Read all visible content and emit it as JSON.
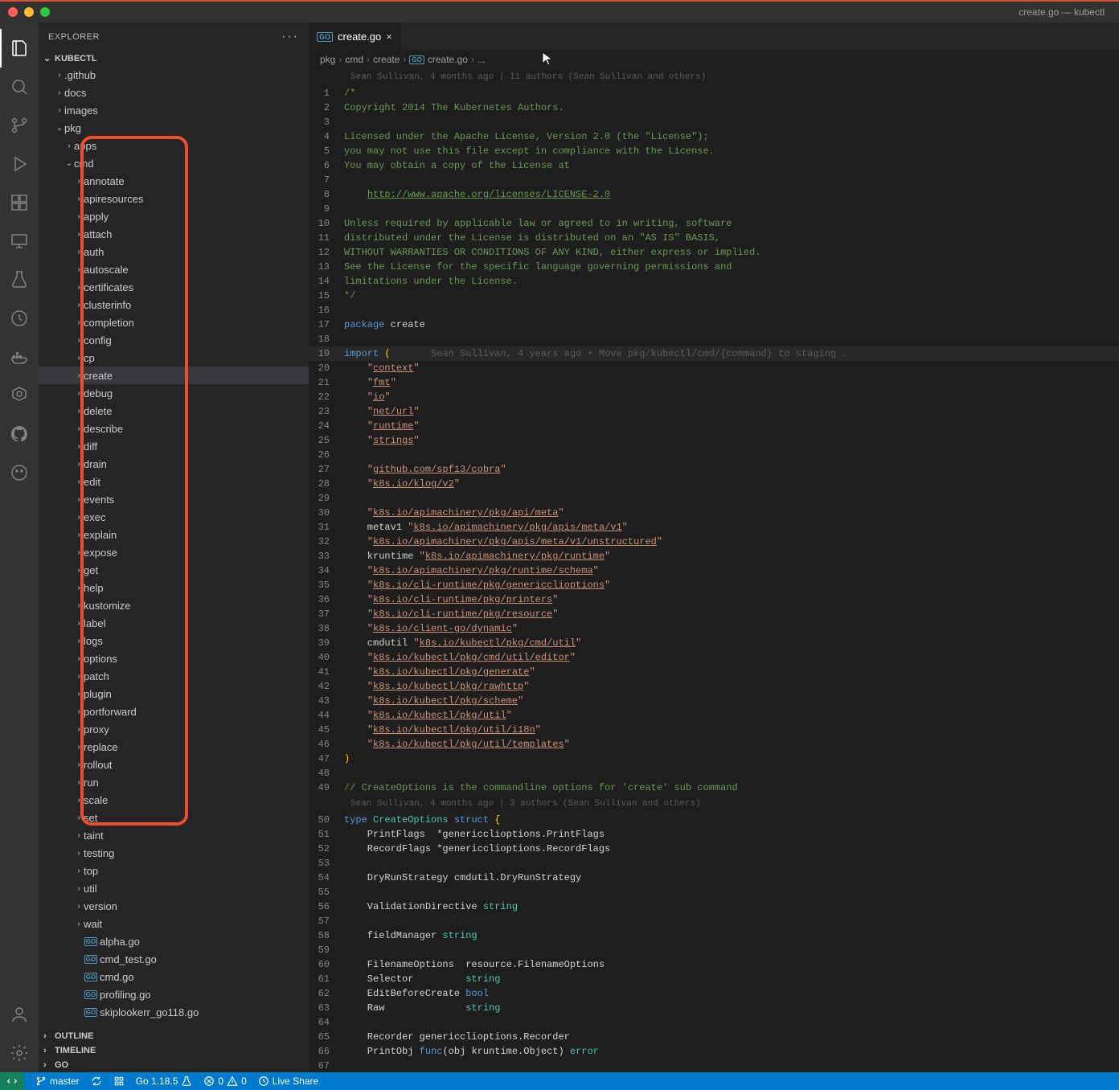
{
  "window": {
    "title": "create.go — kubectl"
  },
  "sidebar": {
    "header": "EXPLORER",
    "sections": {
      "project": "KUBECTL",
      "outline": "OUTLINE",
      "timeline": "TIMELINE",
      "golang": "GO"
    },
    "tree": [
      {
        "label": ".github",
        "depth": 1,
        "type": "folder",
        "expanded": false
      },
      {
        "label": "docs",
        "depth": 1,
        "type": "folder",
        "expanded": false
      },
      {
        "label": "images",
        "depth": 1,
        "type": "folder",
        "expanded": false
      },
      {
        "label": "pkg",
        "depth": 1,
        "type": "folder",
        "expanded": true
      },
      {
        "label": "apps",
        "depth": 2,
        "type": "folder",
        "expanded": false
      },
      {
        "label": "cmd",
        "depth": 2,
        "type": "folder",
        "expanded": true
      },
      {
        "label": "annotate",
        "depth": 3,
        "type": "folder",
        "expanded": false
      },
      {
        "label": "apiresources",
        "depth": 3,
        "type": "folder",
        "expanded": false
      },
      {
        "label": "apply",
        "depth": 3,
        "type": "folder",
        "expanded": false
      },
      {
        "label": "attach",
        "depth": 3,
        "type": "folder",
        "expanded": false
      },
      {
        "label": "auth",
        "depth": 3,
        "type": "folder",
        "expanded": false
      },
      {
        "label": "autoscale",
        "depth": 3,
        "type": "folder",
        "expanded": false
      },
      {
        "label": "certificates",
        "depth": 3,
        "type": "folder",
        "expanded": false
      },
      {
        "label": "clusterinfo",
        "depth": 3,
        "type": "folder",
        "expanded": false
      },
      {
        "label": "completion",
        "depth": 3,
        "type": "folder",
        "expanded": false
      },
      {
        "label": "config",
        "depth": 3,
        "type": "folder",
        "expanded": false
      },
      {
        "label": "cp",
        "depth": 3,
        "type": "folder",
        "expanded": false
      },
      {
        "label": "create",
        "depth": 3,
        "type": "folder",
        "expanded": false,
        "selected": true
      },
      {
        "label": "debug",
        "depth": 3,
        "type": "folder",
        "expanded": false
      },
      {
        "label": "delete",
        "depth": 3,
        "type": "folder",
        "expanded": false
      },
      {
        "label": "describe",
        "depth": 3,
        "type": "folder",
        "expanded": false
      },
      {
        "label": "diff",
        "depth": 3,
        "type": "folder",
        "expanded": false
      },
      {
        "label": "drain",
        "depth": 3,
        "type": "folder",
        "expanded": false
      },
      {
        "label": "edit",
        "depth": 3,
        "type": "folder",
        "expanded": false
      },
      {
        "label": "events",
        "depth": 3,
        "type": "folder",
        "expanded": false
      },
      {
        "label": "exec",
        "depth": 3,
        "type": "folder",
        "expanded": false
      },
      {
        "label": "explain",
        "depth": 3,
        "type": "folder",
        "expanded": false
      },
      {
        "label": "expose",
        "depth": 3,
        "type": "folder",
        "expanded": false
      },
      {
        "label": "get",
        "depth": 3,
        "type": "folder",
        "expanded": false
      },
      {
        "label": "help",
        "depth": 3,
        "type": "folder",
        "expanded": false
      },
      {
        "label": "kustomize",
        "depth": 3,
        "type": "folder",
        "expanded": false
      },
      {
        "label": "label",
        "depth": 3,
        "type": "folder",
        "expanded": false
      },
      {
        "label": "logs",
        "depth": 3,
        "type": "folder",
        "expanded": false
      },
      {
        "label": "options",
        "depth": 3,
        "type": "folder",
        "expanded": false
      },
      {
        "label": "patch",
        "depth": 3,
        "type": "folder",
        "expanded": false
      },
      {
        "label": "plugin",
        "depth": 3,
        "type": "folder",
        "expanded": false
      },
      {
        "label": "portforward",
        "depth": 3,
        "type": "folder",
        "expanded": false
      },
      {
        "label": "proxy",
        "depth": 3,
        "type": "folder",
        "expanded": false
      },
      {
        "label": "replace",
        "depth": 3,
        "type": "folder",
        "expanded": false
      },
      {
        "label": "rollout",
        "depth": 3,
        "type": "folder",
        "expanded": false
      },
      {
        "label": "run",
        "depth": 3,
        "type": "folder",
        "expanded": false
      },
      {
        "label": "scale",
        "depth": 3,
        "type": "folder",
        "expanded": false
      },
      {
        "label": "set",
        "depth": 3,
        "type": "folder",
        "expanded": false
      },
      {
        "label": "taint",
        "depth": 3,
        "type": "folder",
        "expanded": false
      },
      {
        "label": "testing",
        "depth": 3,
        "type": "folder",
        "expanded": false
      },
      {
        "label": "top",
        "depth": 3,
        "type": "folder",
        "expanded": false
      },
      {
        "label": "util",
        "depth": 3,
        "type": "folder",
        "expanded": false
      },
      {
        "label": "version",
        "depth": 3,
        "type": "folder",
        "expanded": false
      },
      {
        "label": "wait",
        "depth": 3,
        "type": "folder",
        "expanded": false
      },
      {
        "label": "alpha.go",
        "depth": 3,
        "type": "go"
      },
      {
        "label": "cmd_test.go",
        "depth": 3,
        "type": "go"
      },
      {
        "label": "cmd.go",
        "depth": 3,
        "type": "go"
      },
      {
        "label": "profiling.go",
        "depth": 3,
        "type": "go"
      },
      {
        "label": "skiplookerr_go118.go",
        "depth": 3,
        "type": "go"
      }
    ]
  },
  "tab": {
    "filename": "create.go"
  },
  "breadcrumb": [
    "pkg",
    "cmd",
    "create",
    "create.go",
    "..."
  ],
  "blame": {
    "top": "Sean Sullivan, 4 months ago | 11 authors (Sean Sullivan and others)",
    "import_hint": "Sean Sullivan, 4 years ago • Move pkg/kubectl/cmd/{command} to staging …",
    "struct_hint": "Sean Sullivan, 4 months ago | 3 authors (Sean Sullivan and others)"
  },
  "code": [
    {
      "n": 1,
      "html": "<span class='c-comment'>/*</span>"
    },
    {
      "n": 2,
      "html": "<span class='c-comment'>Copyright 2014 The Kubernetes Authors.</span>"
    },
    {
      "n": 3,
      "html": ""
    },
    {
      "n": 4,
      "html": "<span class='c-comment'>Licensed under the Apache License, Version 2.0 (the \"License\");</span>"
    },
    {
      "n": 5,
      "html": "<span class='c-comment'>you may not use this file except in compliance with the License.</span>"
    },
    {
      "n": 6,
      "html": "<span class='c-comment'>You may obtain a copy of the License at</span>"
    },
    {
      "n": 7,
      "html": ""
    },
    {
      "n": 8,
      "html": "<span class='c-comment'>    <span class='c-url'>http://www.apache.org/licenses/LICENSE-2.0</span></span>"
    },
    {
      "n": 9,
      "html": ""
    },
    {
      "n": 10,
      "html": "<span class='c-comment'>Unless required by applicable law or agreed to in writing, software</span>"
    },
    {
      "n": 11,
      "html": "<span class='c-comment'>distributed under the License is distributed on an \"AS IS\" BASIS,</span>"
    },
    {
      "n": 12,
      "html": "<span class='c-comment'>WITHOUT WARRANTIES OR CONDITIONS OF ANY KIND, either express or implied.</span>"
    },
    {
      "n": 13,
      "html": "<span class='c-comment'>See the License for the specific language governing permissions and</span>"
    },
    {
      "n": 14,
      "html": "<span class='c-comment'>limitations under the License.</span>"
    },
    {
      "n": 15,
      "html": "<span class='c-comment'>*/</span>"
    },
    {
      "n": 16,
      "html": ""
    },
    {
      "n": 17,
      "html": "<span class='c-kw'>package</span> create"
    },
    {
      "n": 18,
      "html": ""
    },
    {
      "n": 19,
      "hl": true,
      "html": "<span class='c-kw'>import</span> <span class='c-punc'>(</span>       <span class='c-hint'>Sean Sullivan, 4 years ago • Move pkg/kubectl/cmd/{command} to staging …</span>"
    },
    {
      "n": 20,
      "html": "    <span class='c-str'>\"<span class='c-strlink'>context</span>\"</span>"
    },
    {
      "n": 21,
      "html": "    <span class='c-str'>\"<span class='c-strlink'>fmt</span>\"</span>"
    },
    {
      "n": 22,
      "html": "    <span class='c-str'>\"<span class='c-strlink'>io</span>\"</span>"
    },
    {
      "n": 23,
      "html": "    <span class='c-str'>\"<span class='c-strlink'>net/url</span>\"</span>"
    },
    {
      "n": 24,
      "html": "    <span class='c-str'>\"<span class='c-strlink'>runtime</span>\"</span>"
    },
    {
      "n": 25,
      "html": "    <span class='c-str'>\"<span class='c-strlink'>strings</span>\"</span>"
    },
    {
      "n": 26,
      "html": ""
    },
    {
      "n": 27,
      "html": "    <span class='c-str'>\"<span class='c-strlink'>github.com/spf13/cobra</span>\"</span>"
    },
    {
      "n": 28,
      "html": "    <span class='c-str'>\"<span class='c-strlink'>k8s.io/klog/v2</span>\"</span>"
    },
    {
      "n": 29,
      "html": ""
    },
    {
      "n": 30,
      "html": "    <span class='c-str'>\"<span class='c-strlink'>k8s.io/apimachinery/pkg/api/meta</span>\"</span>"
    },
    {
      "n": 31,
      "html": "    metav1 <span class='c-str'>\"<span class='c-strlink'>k8s.io/apimachinery/pkg/apis/meta/v1</span>\"</span>"
    },
    {
      "n": 32,
      "html": "    <span class='c-str'>\"<span class='c-strlink'>k8s.io/apimachinery/pkg/apis/meta/v1/unstructured</span>\"</span>"
    },
    {
      "n": 33,
      "html": "    kruntime <span class='c-str'>\"<span class='c-strlink'>k8s.io/apimachinery/pkg/runtime</span>\"</span>"
    },
    {
      "n": 34,
      "html": "    <span class='c-str'>\"<span class='c-strlink'>k8s.io/apimachinery/pkg/runtime/schema</span>\"</span>"
    },
    {
      "n": 35,
      "html": "    <span class='c-str'>\"<span class='c-strlink'>k8s.io/cli-runtime/pkg/genericclioptions</span>\"</span>"
    },
    {
      "n": 36,
      "html": "    <span class='c-str'>\"<span class='c-strlink'>k8s.io/cli-runtime/pkg/printers</span>\"</span>"
    },
    {
      "n": 37,
      "html": "    <span class='c-str'>\"<span class='c-strlink'>k8s.io/cli-runtime/pkg/resource</span>\"</span>"
    },
    {
      "n": 38,
      "html": "    <span class='c-str'>\"<span class='c-strlink'>k8s.io/client-go/dynamic</span>\"</span>"
    },
    {
      "n": 39,
      "html": "    cmdutil <span class='c-str'>\"<span class='c-strlink'>k8s.io/kubectl/pkg/cmd/util</span>\"</span>"
    },
    {
      "n": 40,
      "html": "    <span class='c-str'>\"<span class='c-strlink'>k8s.io/kubectl/pkg/cmd/util/editor</span>\"</span>"
    },
    {
      "n": 41,
      "html": "    <span class='c-str'>\"<span class='c-strlink'>k8s.io/kubectl/pkg/generate</span>\"</span>"
    },
    {
      "n": 42,
      "html": "    <span class='c-str'>\"<span class='c-strlink'>k8s.io/kubectl/pkg/rawhttp</span>\"</span>"
    },
    {
      "n": 43,
      "html": "    <span class='c-str'>\"<span class='c-strlink'>k8s.io/kubectl/pkg/scheme</span>\"</span>"
    },
    {
      "n": 44,
      "html": "    <span class='c-str'>\"<span class='c-strlink'>k8s.io/kubectl/pkg/util</span>\"</span>"
    },
    {
      "n": 45,
      "html": "    <span class='c-str'>\"<span class='c-strlink'>k8s.io/kubectl/pkg/util/i18n</span>\"</span>"
    },
    {
      "n": 46,
      "html": "    <span class='c-str'>\"<span class='c-strlink'>k8s.io/kubectl/pkg/util/templates</span>\"</span>"
    },
    {
      "n": 47,
      "html": "<span class='c-punc'>)</span>"
    },
    {
      "n": 48,
      "html": ""
    },
    {
      "n": 49,
      "html": "<span class='c-comment'>// CreateOptions is the commandline options for 'create' sub command</span>"
    },
    {
      "n": 50,
      "html": "<span class='c-kw'>type</span> <span class='c-type'>CreateOptions</span> <span class='c-kw'>struct</span> <span class='c-punc'>{</span>"
    },
    {
      "n": 51,
      "html": "    PrintFlags  *genericclioptions.PrintFlags"
    },
    {
      "n": 52,
      "html": "    RecordFlags *genericclioptions.RecordFlags"
    },
    {
      "n": 53,
      "html": ""
    },
    {
      "n": 54,
      "html": "    DryRunStrategy cmdutil.DryRunStrategy"
    },
    {
      "n": 55,
      "html": ""
    },
    {
      "n": 56,
      "html": "    ValidationDirective <span class='c-type'>string</span>"
    },
    {
      "n": 57,
      "html": ""
    },
    {
      "n": 58,
      "html": "    fieldManager <span class='c-type'>string</span>"
    },
    {
      "n": 59,
      "html": ""
    },
    {
      "n": 60,
      "html": "    FilenameOptions  resource.FilenameOptions"
    },
    {
      "n": 61,
      "html": "    Selector         <span class='c-type'>string</span>"
    },
    {
      "n": 62,
      "html": "    EditBeforeCreate <span class='c-kw'>bool</span>"
    },
    {
      "n": 63,
      "html": "    Raw              <span class='c-type'>string</span>"
    },
    {
      "n": 64,
      "html": ""
    },
    {
      "n": 65,
      "html": "    Recorder genericclioptions.Recorder"
    },
    {
      "n": 66,
      "html": "    PrintObj <span class='c-kw'>func</span>(obj kruntime.Object) <span class='c-type'>error</span>"
    },
    {
      "n": 67,
      "html": ""
    }
  ],
  "status": {
    "branch": "master",
    "go_version": "Go 1.18.5",
    "errors": "0",
    "warnings": "0",
    "live_share": "Live Share"
  }
}
